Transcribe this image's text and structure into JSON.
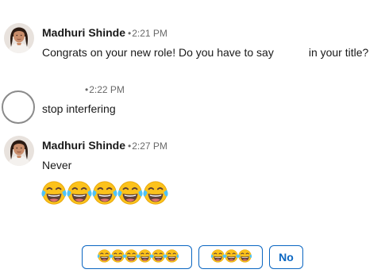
{
  "messages": [
    {
      "sender": "Madhuri Shinde",
      "separator": "•",
      "time": "2:21 PM",
      "text_before": "Congrats on your new role! Do you have to say",
      "text_after": "in your title?"
    },
    {
      "sender": "",
      "separator": "•",
      "time": "2:22 PM",
      "text": "stop interfering"
    },
    {
      "sender": "Madhuri Shinde",
      "separator": "•",
      "time": "2:27 PM",
      "text": "Never",
      "emoji_count": 5,
      "emoji": "face-with-tears-of-joy"
    }
  ],
  "quick_replies": [
    {
      "label": "",
      "emoji": "face-with-tears-of-joy",
      "emoji_count": 6
    },
    {
      "label": "",
      "emoji": "face-with-tears-of-joy",
      "emoji_count": 3
    },
    {
      "label": "No"
    }
  ],
  "colors": {
    "accent": "#0a66c2",
    "emoji_face": "#fcc21b",
    "tears": "#4fc3f7"
  }
}
